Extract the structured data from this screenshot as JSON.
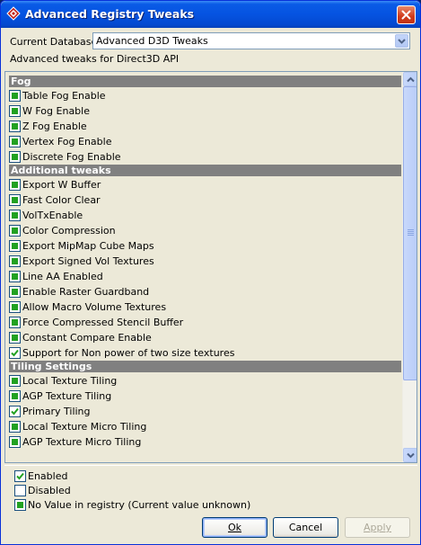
{
  "window": {
    "title": "Advanced Registry Tweaks",
    "close_icon": "close-icon",
    "app_icon": "ati-logo-icon"
  },
  "database": {
    "label": "Current Database",
    "selected": "Advanced D3D Tweaks",
    "description": "Advanced tweaks for Direct3D API"
  },
  "sections": [
    {
      "title": "Fog",
      "items": [
        {
          "label": "Table Fog Enable",
          "state": "unknown"
        },
        {
          "label": "W Fog Enable",
          "state": "unknown"
        },
        {
          "label": "Z Fog Enable",
          "state": "unknown"
        },
        {
          "label": "Vertex Fog Enable",
          "state": "unknown"
        },
        {
          "label": "Discrete Fog Enable",
          "state": "unknown"
        }
      ]
    },
    {
      "title": "Additional tweaks",
      "items": [
        {
          "label": "Export W Buffer",
          "state": "unknown"
        },
        {
          "label": "Fast Color Clear",
          "state": "unknown"
        },
        {
          "label": "VolTxEnable",
          "state": "unknown"
        },
        {
          "label": "Color Compression",
          "state": "unknown"
        },
        {
          "label": "Export MipMap Cube Maps",
          "state": "unknown"
        },
        {
          "label": "Export Signed Vol Textures",
          "state": "unknown"
        },
        {
          "label": "Line AA Enabled",
          "state": "unknown"
        },
        {
          "label": "Enable Raster Guardband",
          "state": "unknown"
        },
        {
          "label": "Allow Macro Volume Textures",
          "state": "unknown"
        },
        {
          "label": "Force Compressed Stencil Buffer",
          "state": "unknown"
        },
        {
          "label": "Constant Compare Enable",
          "state": "unknown"
        },
        {
          "label": "Support for Non power of two size textures",
          "state": "enabled"
        }
      ]
    },
    {
      "title": "Tiling Settings",
      "items": [
        {
          "label": "Local Texture Tiling",
          "state": "unknown"
        },
        {
          "label": "AGP Texture Tiling",
          "state": "unknown"
        },
        {
          "label": "Primary Tiling",
          "state": "enabled"
        },
        {
          "label": "Local Texture Micro Tiling",
          "state": "unknown"
        },
        {
          "label": "AGP Texture Micro Tiling",
          "state": "unknown"
        }
      ]
    }
  ],
  "legend": [
    {
      "label": "Enabled",
      "state": "enabled"
    },
    {
      "label": "Disabled",
      "state": "disabled"
    },
    {
      "label": "No Value in registry (Current value unknown)",
      "state": "unknown"
    }
  ],
  "buttons": {
    "ok": "Ok",
    "cancel": "Cancel",
    "apply": "Apply"
  },
  "colors": {
    "section_header": "#808080",
    "unknown_fill": "#21a121",
    "check_mark": "#21a121",
    "title_bar": "#0553e1"
  }
}
